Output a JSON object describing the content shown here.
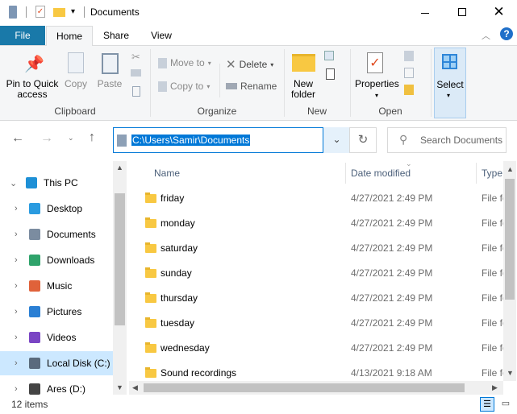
{
  "title": "Documents",
  "tabs": {
    "file": "File",
    "home": "Home",
    "share": "Share",
    "view": "View"
  },
  "ribbon": {
    "pin": "Pin to Quick access",
    "copy": "Copy",
    "paste": "Paste",
    "clipboard": "Clipboard",
    "move_to": "Move to",
    "copy_to": "Copy to",
    "delete": "Delete",
    "rename": "Rename",
    "organize": "Organize",
    "new_folder": "New folder",
    "new": "New",
    "properties": "Properties",
    "open": "Open",
    "select": "Select"
  },
  "address": {
    "path": "C:\\Users\\Samir\\Documents",
    "search_placeholder": "Search Documents"
  },
  "nav": [
    {
      "label": "This PC",
      "color": "#1e90d6"
    },
    {
      "label": "Desktop",
      "color": "#2a9be0"
    },
    {
      "label": "Documents",
      "color": "#7b8ca0"
    },
    {
      "label": "Downloads",
      "color": "#2fa36b"
    },
    {
      "label": "Music",
      "color": "#e0623a"
    },
    {
      "label": "Pictures",
      "color": "#2a7fd4"
    },
    {
      "label": "Videos",
      "color": "#7a45c4"
    },
    {
      "label": "Local Disk (C:)",
      "color": "#5a6b7d"
    },
    {
      "label": "Ares (D:)",
      "color": "#444"
    }
  ],
  "columns": {
    "name": "Name",
    "date": "Date modified",
    "type": "Type"
  },
  "files": [
    {
      "name": "friday",
      "date": "4/27/2021 2:49 PM",
      "type": "File folder"
    },
    {
      "name": "monday",
      "date": "4/27/2021 2:49 PM",
      "type": "File folder"
    },
    {
      "name": "saturday",
      "date": "4/27/2021 2:49 PM",
      "type": "File folder"
    },
    {
      "name": "sunday",
      "date": "4/27/2021 2:49 PM",
      "type": "File folder"
    },
    {
      "name": "thursday",
      "date": "4/27/2021 2:49 PM",
      "type": "File folder"
    },
    {
      "name": "tuesday",
      "date": "4/27/2021 2:49 PM",
      "type": "File folder"
    },
    {
      "name": "wednesday",
      "date": "4/27/2021 2:49 PM",
      "type": "File folder"
    },
    {
      "name": "Sound recordings",
      "date": "4/13/2021 9:18 AM",
      "type": "File folder"
    }
  ],
  "status": {
    "count": "12 items"
  }
}
